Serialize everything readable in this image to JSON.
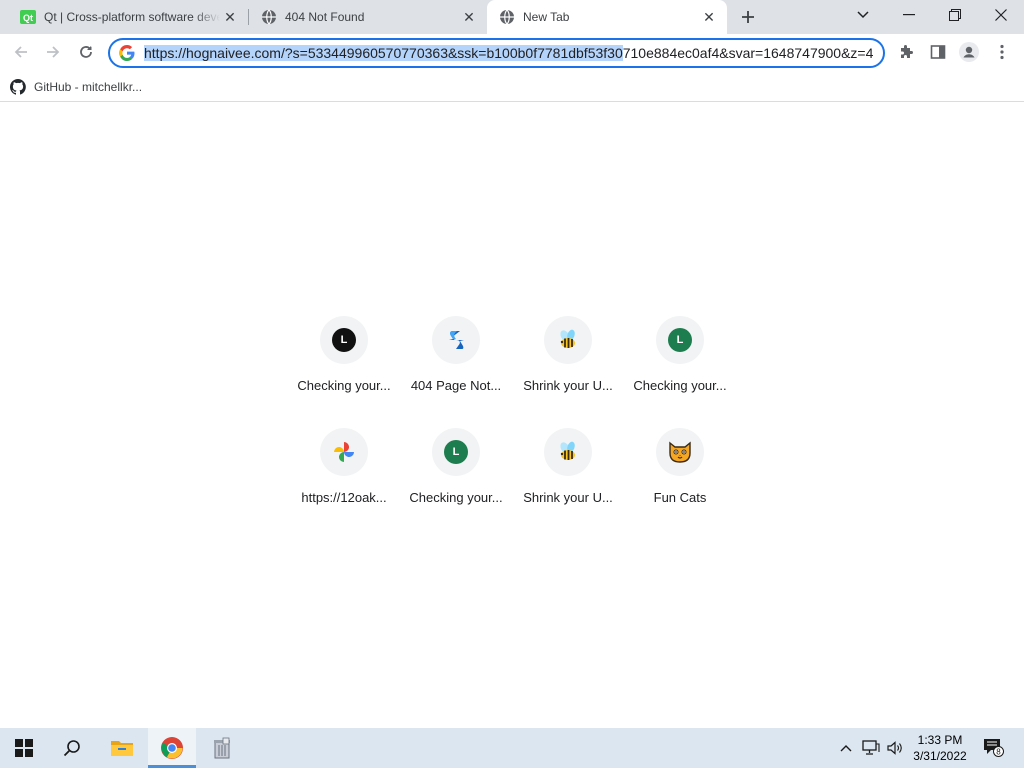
{
  "tabs": [
    {
      "title": "Qt | Cross-platform software development for embedded & desktop",
      "favicon": "qt-icon",
      "active": false
    },
    {
      "title": "404 Not Found",
      "favicon": "globe-icon",
      "active": false
    },
    {
      "title": "New Tab",
      "favicon": "globe-icon",
      "active": true
    }
  ],
  "omnibox": {
    "url_selected": "https://hognaivee.com/?s=533449960570770363&ssk=b100b0f7781dbf53f30",
    "url_rest": "710e884ec0af4&svar=1648747900&z=4"
  },
  "bookmarks": [
    {
      "label": "GitHub - mitchellkr...",
      "icon": "github-icon"
    }
  ],
  "shortcuts": [
    {
      "label": "Checking your...",
      "icon": "letter-l-black",
      "letter": "L",
      "color": "#111111"
    },
    {
      "label": "404 Page Not...",
      "icon": "blue-s-icon"
    },
    {
      "label": "Shrink your U...",
      "icon": "bee-icon"
    },
    {
      "label": "Checking your...",
      "icon": "letter-l-green",
      "letter": "L",
      "color": "#1e7d4f"
    },
    {
      "label": "https://12oak...",
      "icon": "pinwheel-icon"
    },
    {
      "label": "Checking your...",
      "icon": "letter-l-green",
      "letter": "L",
      "color": "#1e7d4f"
    },
    {
      "label": "Shrink your U...",
      "icon": "bee-icon"
    },
    {
      "label": "Fun Cats",
      "icon": "cat-icon"
    }
  ],
  "taskbar": {
    "time": "1:33 PM",
    "date": "3/31/2022",
    "notification_count": "8"
  },
  "colors": {
    "accent": "#1a73e8",
    "selection": "#b4d4fb",
    "tabstrip": "#dee1e6",
    "taskbar": "#dce6f0"
  }
}
